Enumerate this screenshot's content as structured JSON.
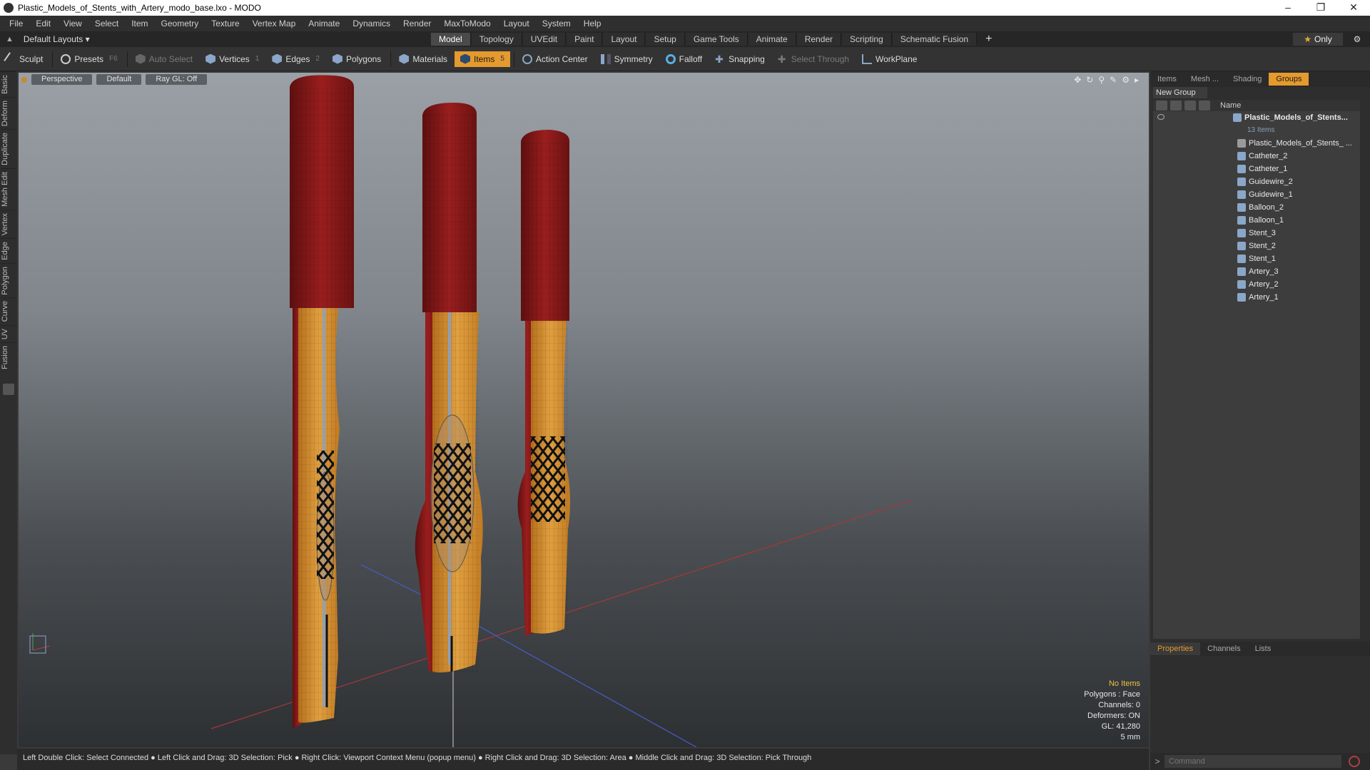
{
  "window": {
    "title": "Plastic_Models_of_Stents_with_Artery_modo_base.lxo - MODO",
    "minimize": "–",
    "restore": "❐",
    "close": "✕"
  },
  "menubar": [
    "File",
    "Edit",
    "View",
    "Select",
    "Item",
    "Geometry",
    "Texture",
    "Vertex Map",
    "Animate",
    "Dynamics",
    "Render",
    "MaxToModo",
    "Layout",
    "System",
    "Help"
  ],
  "layouts": {
    "label": "Default Layouts ▾"
  },
  "modetabs": [
    "Model",
    "Topology",
    "UVEdit",
    "Paint",
    "Layout",
    "Setup",
    "Game Tools",
    "Animate",
    "Render",
    "Scripting",
    "Schematic Fusion"
  ],
  "modetab_active": "Model",
  "only_label": "Only",
  "toolbar": {
    "sculpt": "Sculpt",
    "presets": "Presets",
    "presets_key": "F6",
    "auto_select": "Auto Select",
    "vertices": "Vertices",
    "vertices_key": "1",
    "edges": "Edges",
    "edges_key": "2",
    "polygons": "Polygons",
    "materials": "Materials",
    "items": "Items",
    "items_key": "5",
    "action_center": "Action Center",
    "symmetry": "Symmetry",
    "falloff": "Falloff",
    "snapping": "Snapping",
    "select_through": "Select Through",
    "workplane": "WorkPlane"
  },
  "left_tabs": [
    "Basic",
    "Deform",
    "Duplicate",
    "Mesh Edit",
    "Vertex",
    "Edge",
    "Polygon",
    "Curve",
    "UV",
    "Fusion"
  ],
  "viewport": {
    "view": "Perspective",
    "shading": "Default",
    "raygl": "Ray GL: Off",
    "info": {
      "selection": "No Items",
      "polygons": "Polygons : Face",
      "channels": "Channels: 0",
      "deformers": "Deformers: ON",
      "gl": "GL: 41,280",
      "scale": "5 mm"
    },
    "colors": {
      "artery_red": "#8e1a1a",
      "wall_orange": "#d08a2a",
      "stent": "#1a1a1a",
      "guidewire": "#8fa0b8"
    }
  },
  "statusbar": "Left Double Click: Select Connected ● Left Click and Drag: 3D Selection: Pick ● Right Click: Viewport Context Menu (popup menu) ● Right Click and Drag: 3D Selection: Area ● Middle Click and Drag: 3D Selection: Pick Through",
  "rightpanel": {
    "tabs": [
      "Items",
      "Mesh ...",
      "Shading",
      "Groups"
    ],
    "active_tab": "Groups",
    "new_group": "New Group",
    "name_header": "Name",
    "root": "Plastic_Models_of_Stents...",
    "root_count": "13 Items",
    "items": [
      "Plastic_Models_of_Stents_ ...",
      "Catheter_2",
      "Catheter_1",
      "Guidewire_2",
      "Guidewire_1",
      "Balloon_2",
      "Balloon_1",
      "Stent_3",
      "Stent_2",
      "Stent_1",
      "Artery_3",
      "Artery_2",
      "Artery_1"
    ],
    "bottom_tabs": [
      "Properties",
      "Channels",
      "Lists"
    ],
    "bottom_active": "Properties",
    "command_placeholder": "Command"
  }
}
